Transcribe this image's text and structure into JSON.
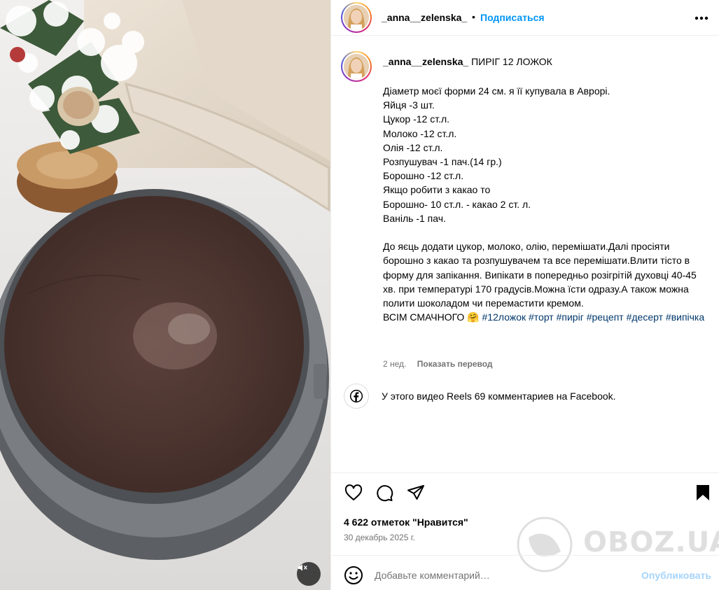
{
  "post": {
    "username": "_anna__zelenska_",
    "follow_label": "Подписаться",
    "dot": "•",
    "caption_title": "ПИРІГ 12 ЛОЖОК",
    "caption_lines": [
      "Діаметр моєї форми 24 см. я її купувала в Аврорі.",
      "Яйця -3 шт.",
      "Цукор -12 ст.л.",
      "Молоко -12 ст.л.",
      "Олія -12 ст.л.",
      "Розпушувач -1 пач.(14 гр.)",
      "Борошно -12 ст.л.",
      "Якщо робити з какао то",
      "Борошно- 10 ст.л. - какао 2 ст. л.",
      "Ваніль -1 пач."
    ],
    "caption_paragraph": "До яєць додати цукор, молоко, олію, перемішати.Далі просіяти борошно з какао та розпушувачем та все перемішати.Влити тісто в форму для запікання. Випікати в попередньо розігрітій духовці 40-45 хв. при температурі 170 градусів.Можна їсти одразу.А також можна полити шоколадом чи перемастити кремом.",
    "caption_ending": "ВСІМ СМАЧНОГО 🤗",
    "hashtags": [
      "#12ложок",
      "#торт",
      "#пиріг",
      "#рецепт",
      "#десерт",
      "#випічка"
    ],
    "age": "2 нед.",
    "translate_label": "Показать перевод",
    "facebook_comments": "У этого видео Reels 69 комментариев на Facebook.",
    "likes": "4 622 отметок \"Нравится\"",
    "date": "30 декабрь 2025 г.",
    "comment_placeholder": "Добавьте комментарий…",
    "publish_label": "Опубликовать",
    "watermark_text": "OBOZ.UA"
  },
  "icons": {
    "more": "more-horizontal-icon",
    "like": "heart-icon",
    "comment": "comment-icon",
    "share": "share-icon",
    "save": "bookmark-icon",
    "emoji": "emoji-icon",
    "facebook": "facebook-icon",
    "mute": "muted-speaker-icon"
  },
  "colors": {
    "accent": "#0095f6",
    "hashtag": "#00376b",
    "muted_text": "#737373",
    "publish_disabled": "#a6d4fb"
  }
}
